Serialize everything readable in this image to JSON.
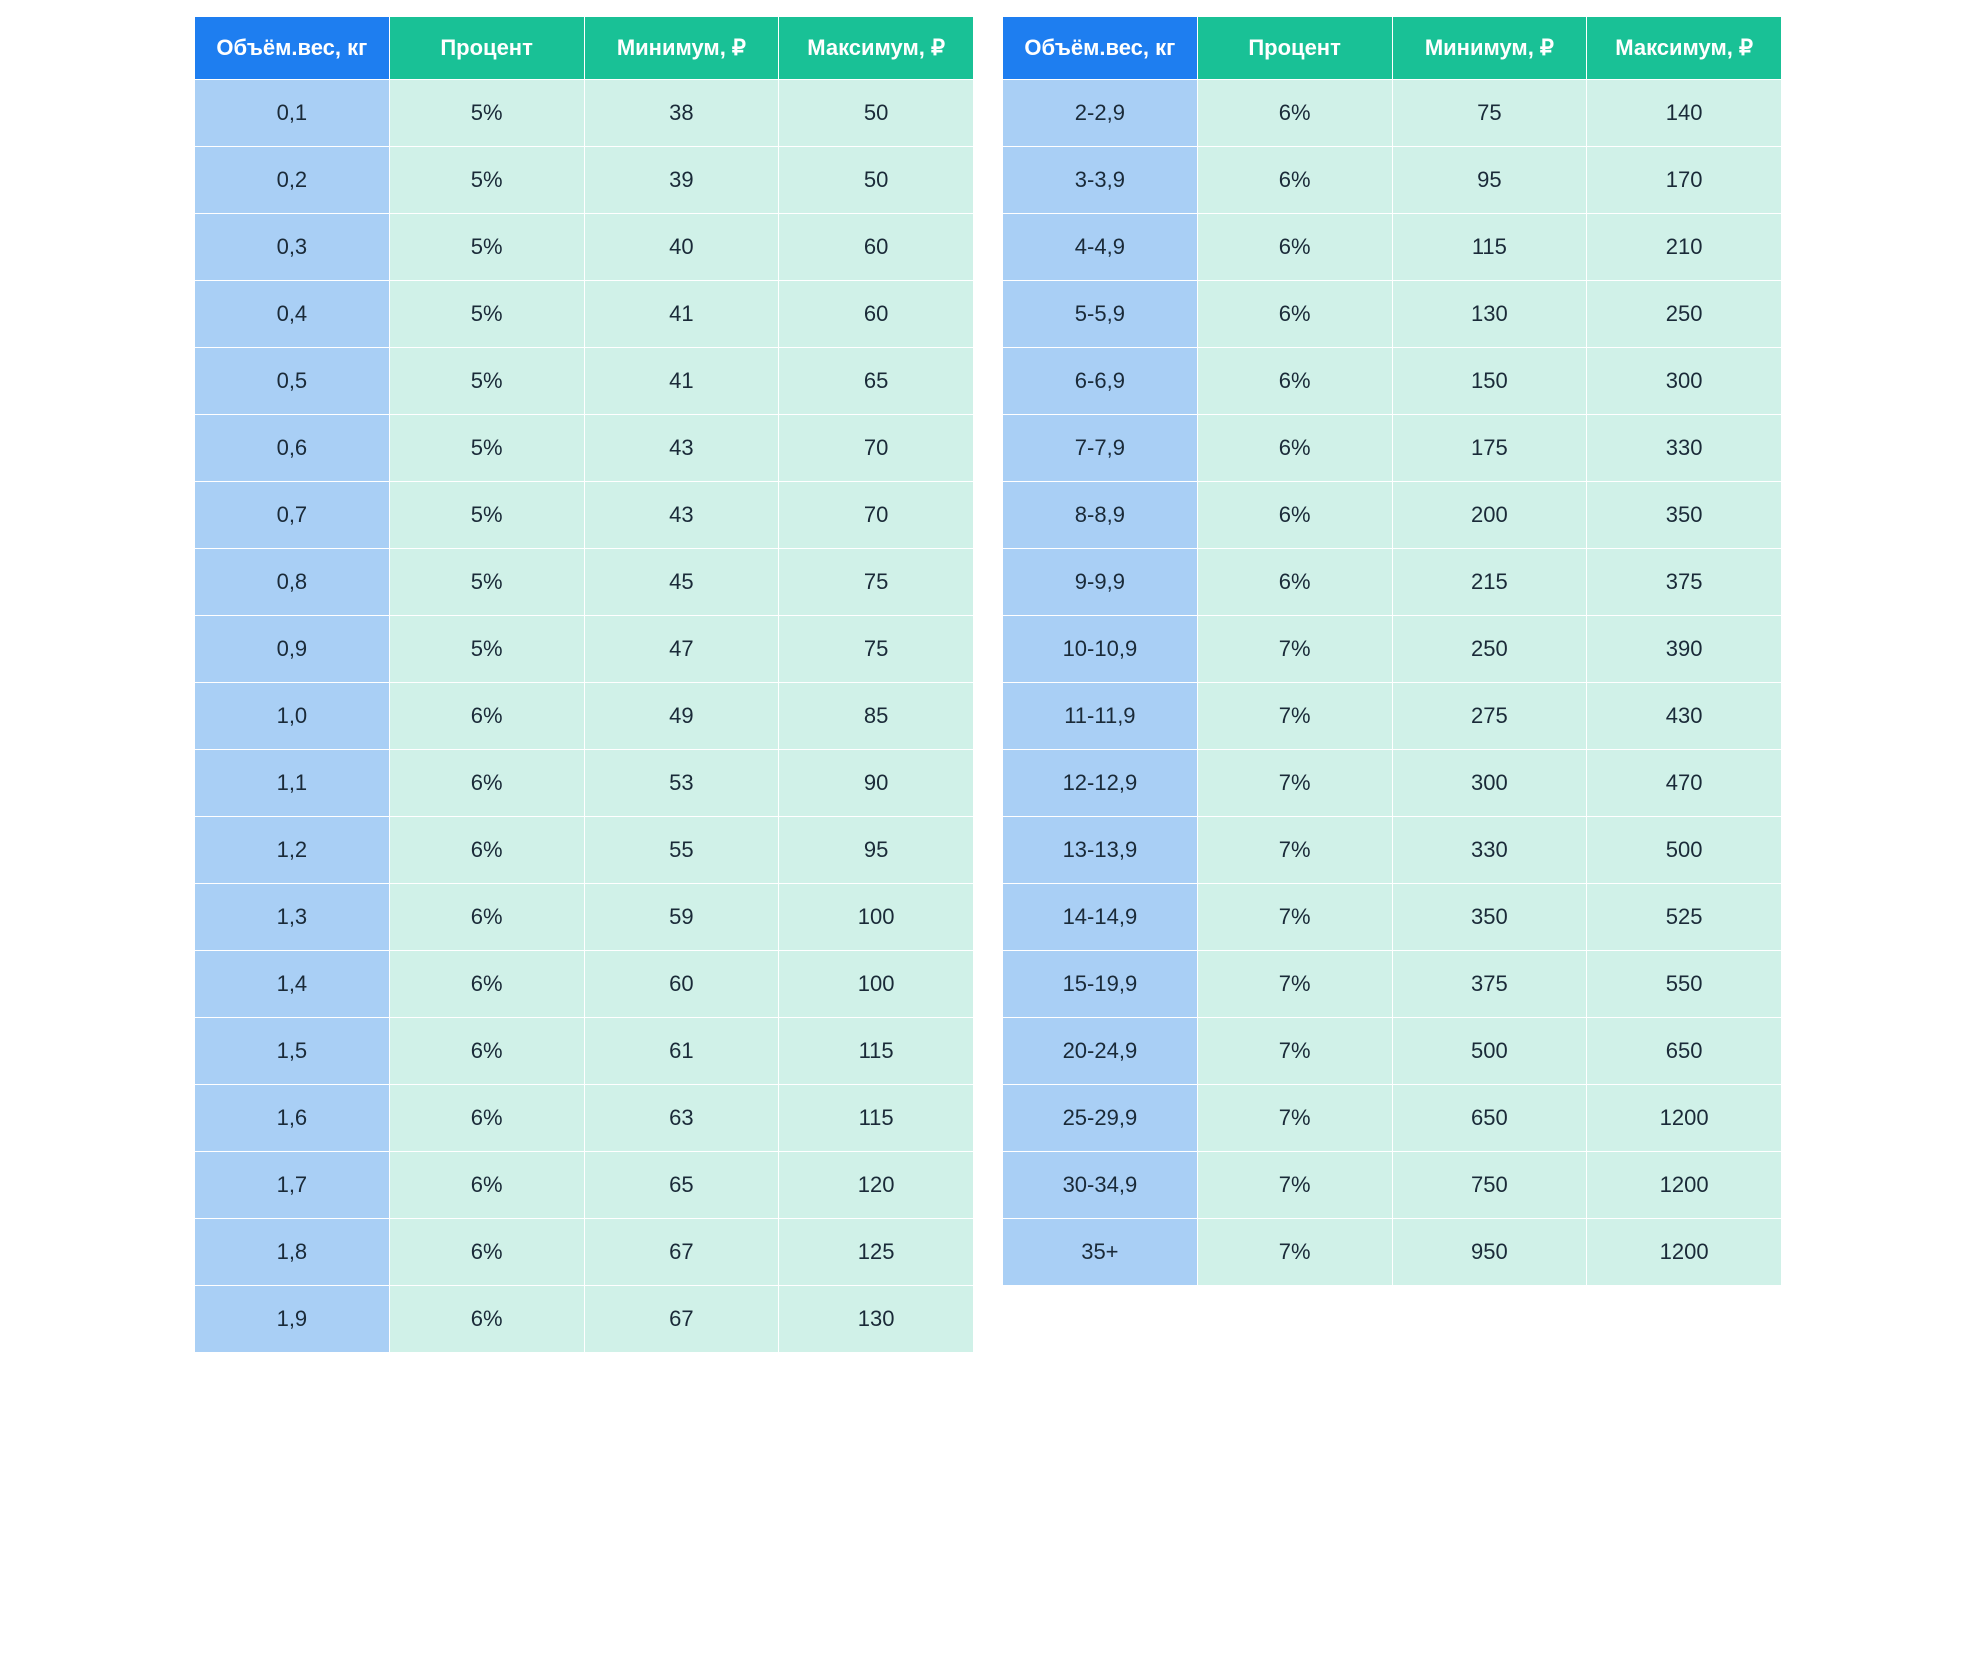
{
  "headers": {
    "weight": "Объём.вес, кг",
    "percent": "Процент",
    "min": "Минимум, ₽",
    "max": "Максимум, ₽"
  },
  "leftRows": [
    {
      "weight": "0,1",
      "percent": "5%",
      "min": "38",
      "max": "50"
    },
    {
      "weight": "0,2",
      "percent": "5%",
      "min": "39",
      "max": "50"
    },
    {
      "weight": "0,3",
      "percent": "5%",
      "min": "40",
      "max": "60"
    },
    {
      "weight": "0,4",
      "percent": "5%",
      "min": "41",
      "max": "60"
    },
    {
      "weight": "0,5",
      "percent": "5%",
      "min": "41",
      "max": "65"
    },
    {
      "weight": "0,6",
      "percent": "5%",
      "min": "43",
      "max": "70"
    },
    {
      "weight": "0,7",
      "percent": "5%",
      "min": "43",
      "max": "70"
    },
    {
      "weight": "0,8",
      "percent": "5%",
      "min": "45",
      "max": "75"
    },
    {
      "weight": "0,9",
      "percent": "5%",
      "min": "47",
      "max": "75"
    },
    {
      "weight": "1,0",
      "percent": "6%",
      "min": "49",
      "max": "85"
    },
    {
      "weight": "1,1",
      "percent": "6%",
      "min": "53",
      "max": "90"
    },
    {
      "weight": "1,2",
      "percent": "6%",
      "min": "55",
      "max": "95"
    },
    {
      "weight": "1,3",
      "percent": "6%",
      "min": "59",
      "max": "100"
    },
    {
      "weight": "1,4",
      "percent": "6%",
      "min": "60",
      "max": "100"
    },
    {
      "weight": "1,5",
      "percent": "6%",
      "min": "61",
      "max": "115"
    },
    {
      "weight": "1,6",
      "percent": "6%",
      "min": "63",
      "max": "115"
    },
    {
      "weight": "1,7",
      "percent": "6%",
      "min": "65",
      "max": "120"
    },
    {
      "weight": "1,8",
      "percent": "6%",
      "min": "67",
      "max": "125"
    },
    {
      "weight": "1,9",
      "percent": "6%",
      "min": "67",
      "max": "130"
    }
  ],
  "rightRows": [
    {
      "weight": "2-2,9",
      "percent": "6%",
      "min": "75",
      "max": "140"
    },
    {
      "weight": "3-3,9",
      "percent": "6%",
      "min": "95",
      "max": "170"
    },
    {
      "weight": "4-4,9",
      "percent": "6%",
      "min": "115",
      "max": "210"
    },
    {
      "weight": "5-5,9",
      "percent": "6%",
      "min": "130",
      "max": "250"
    },
    {
      "weight": "6-6,9",
      "percent": "6%",
      "min": "150",
      "max": "300"
    },
    {
      "weight": "7-7,9",
      "percent": "6%",
      "min": "175",
      "max": "330"
    },
    {
      "weight": "8-8,9",
      "percent": "6%",
      "min": "200",
      "max": "350"
    },
    {
      "weight": "9-9,9",
      "percent": "6%",
      "min": "215",
      "max": "375"
    },
    {
      "weight": "10-10,9",
      "percent": "7%",
      "min": "250",
      "max": "390"
    },
    {
      "weight": "11-11,9",
      "percent": "7%",
      "min": "275",
      "max": "430"
    },
    {
      "weight": "12-12,9",
      "percent": "7%",
      "min": "300",
      "max": "470"
    },
    {
      "weight": "13-13,9",
      "percent": "7%",
      "min": "330",
      "max": "500"
    },
    {
      "weight": "14-14,9",
      "percent": "7%",
      "min": "350",
      "max": "525"
    },
    {
      "weight": "15-19,9",
      "percent": "7%",
      "min": "375",
      "max": "550"
    },
    {
      "weight": "20-24,9",
      "percent": "7%",
      "min": "500",
      "max": "650"
    },
    {
      "weight": "25-29,9",
      "percent": "7%",
      "min": "650",
      "max": "1200"
    },
    {
      "weight": "30-34,9",
      "percent": "7%",
      "min": "750",
      "max": "1200"
    },
    {
      "weight": "35+",
      "percent": "7%",
      "min": "950",
      "max": "1200"
    }
  ]
}
